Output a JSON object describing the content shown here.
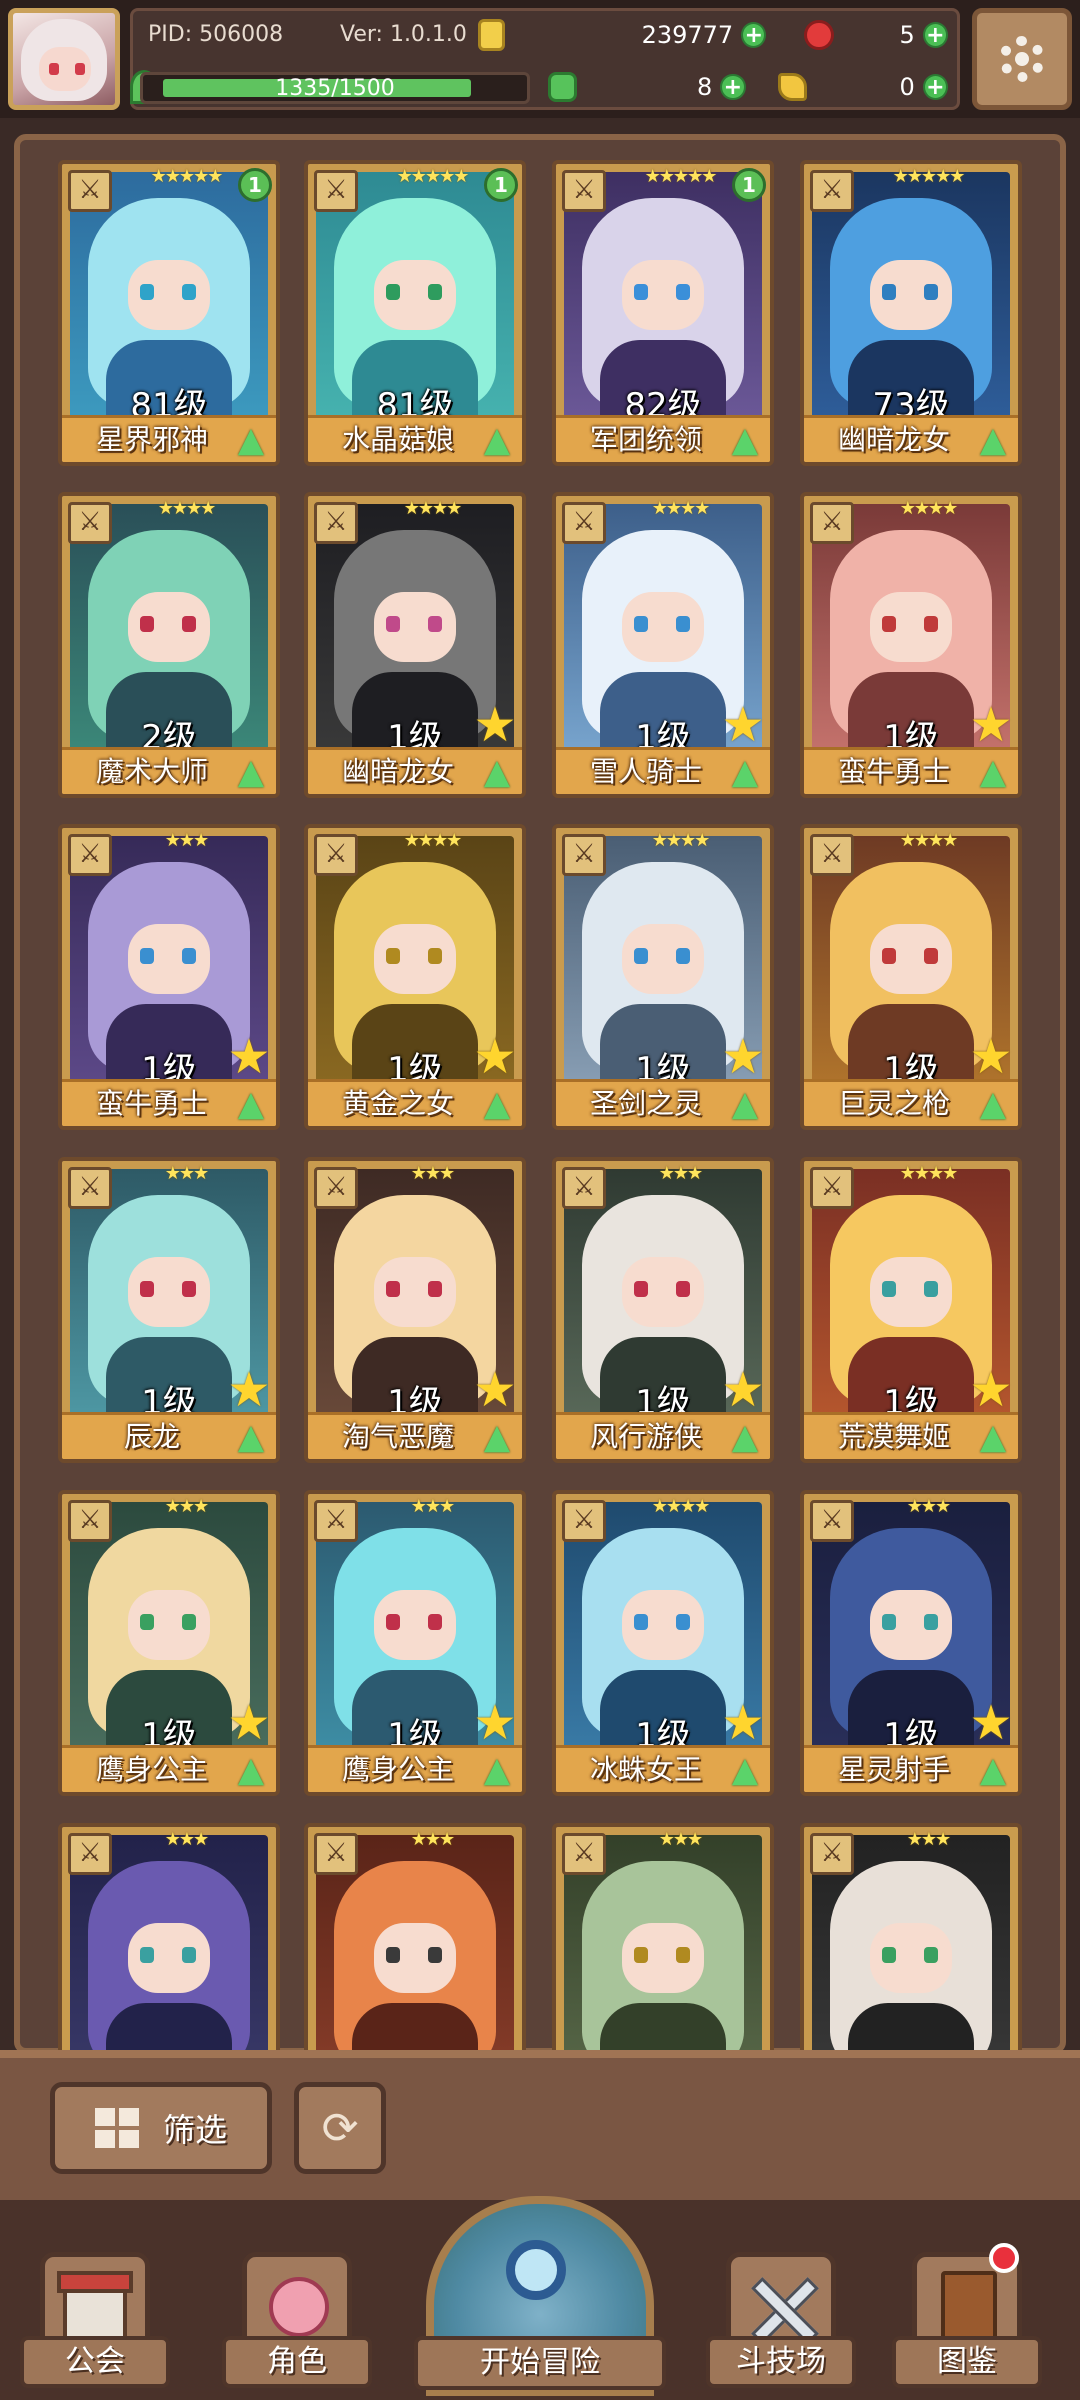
{
  "header": {
    "pid": "PID: 506008",
    "version": "Ver: 1.0.1.0",
    "exp": "1335/1500",
    "exp_fraction": 0.89,
    "coins": "239777",
    "gems": "5",
    "clovers": "8",
    "keys": "0"
  },
  "characters": [
    {
      "name": "星界邪神",
      "level": "81级",
      "stars": "★★★★★",
      "badge": "1",
      "rarity_star": false
    },
    {
      "name": "水晶菇娘",
      "level": "81级",
      "stars": "★★★★★",
      "badge": "1",
      "rarity_star": false
    },
    {
      "name": "军团统领",
      "level": "82级",
      "stars": "★★★★★",
      "badge": "1",
      "rarity_star": false
    },
    {
      "name": "幽暗龙女",
      "level": "73级",
      "stars": "★★★★★",
      "badge": "",
      "rarity_star": false
    },
    {
      "name": "魔术大师",
      "level": "2级",
      "stars": "★★★★",
      "badge": "",
      "rarity_star": false
    },
    {
      "name": "幽暗龙女",
      "level": "1级",
      "stars": "★★★★",
      "badge": "",
      "rarity_star": true
    },
    {
      "name": "雪人骑士",
      "level": "1级",
      "stars": "★★★★",
      "badge": "",
      "rarity_star": true
    },
    {
      "name": "蛮牛勇士",
      "level": "1级",
      "stars": "★★★★",
      "badge": "",
      "rarity_star": true
    },
    {
      "name": "蛮牛勇士",
      "level": "1级",
      "stars": "★★★",
      "badge": "",
      "rarity_star": true
    },
    {
      "name": "黄金之女",
      "level": "1级",
      "stars": "★★★★",
      "badge": "",
      "rarity_star": true
    },
    {
      "name": "圣剑之灵",
      "level": "1级",
      "stars": "★★★★",
      "badge": "",
      "rarity_star": true
    },
    {
      "name": "巨灵之枪",
      "level": "1级",
      "stars": "★★★★",
      "badge": "",
      "rarity_star": true
    },
    {
      "name": "辰龙",
      "level": "1级",
      "stars": "★★★",
      "badge": "",
      "rarity_star": true
    },
    {
      "name": "淘气恶魔",
      "level": "1级",
      "stars": "★★★",
      "badge": "",
      "rarity_star": true
    },
    {
      "name": "风行游侠",
      "level": "1级",
      "stars": "★★★",
      "badge": "",
      "rarity_star": true
    },
    {
      "name": "荒漠舞姬",
      "level": "1级",
      "stars": "★★★★",
      "badge": "",
      "rarity_star": true
    },
    {
      "name": "鹰身公主",
      "level": "1级",
      "stars": "★★★",
      "badge": "",
      "rarity_star": true
    },
    {
      "name": "鹰身公主",
      "level": "1级",
      "stars": "★★★",
      "badge": "",
      "rarity_star": true
    },
    {
      "name": "冰蛛女王",
      "level": "1级",
      "stars": "★★★★",
      "badge": "",
      "rarity_star": true
    },
    {
      "name": "星灵射手",
      "level": "1级",
      "stars": "★★★",
      "badge": "",
      "rarity_star": true
    },
    {
      "name": "",
      "level": "",
      "stars": "★★★",
      "badge": "",
      "rarity_star": false
    },
    {
      "name": "",
      "level": "",
      "stars": "★★★",
      "badge": "",
      "rarity_star": false
    },
    {
      "name": "",
      "level": "",
      "stars": "★★★",
      "badge": "",
      "rarity_star": false
    },
    {
      "name": "",
      "level": "",
      "stars": "★★★",
      "badge": "",
      "rarity_star": false
    }
  ],
  "toolbar": {
    "filter_label": "筛选"
  },
  "nav": {
    "guild": "公会",
    "roles": "角色",
    "adventure": "开始冒险",
    "arena": "斗技场",
    "codex": "图鉴"
  },
  "palette": {
    "accent_green": "#5bbf56",
    "gold": "#ffd52e",
    "frame": "#8a6447"
  }
}
